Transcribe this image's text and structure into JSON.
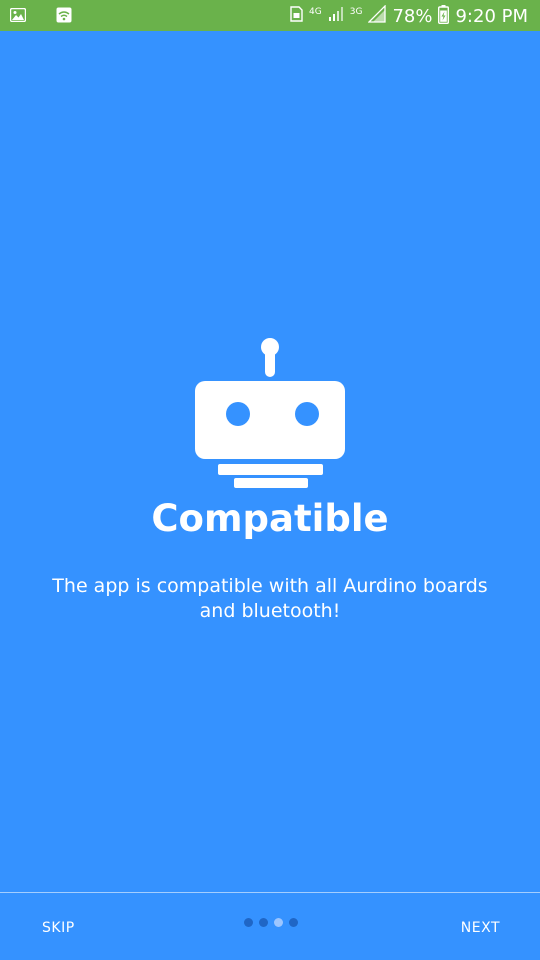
{
  "status_bar": {
    "network_4g": "4G",
    "network_3g": "3G",
    "battery": "78%",
    "time": "9:20 PM"
  },
  "page": {
    "title": "Compatible",
    "description": "The app is compatible with all Aurdino boards and bluetooth!"
  },
  "footer": {
    "skip_label": "SKIP",
    "next_label": "NEXT",
    "page_count": 4,
    "active_page": 3
  },
  "colors": {
    "background": "#3592FF",
    "status_bar": "#6AB24B",
    "text": "#FFFFFF"
  }
}
